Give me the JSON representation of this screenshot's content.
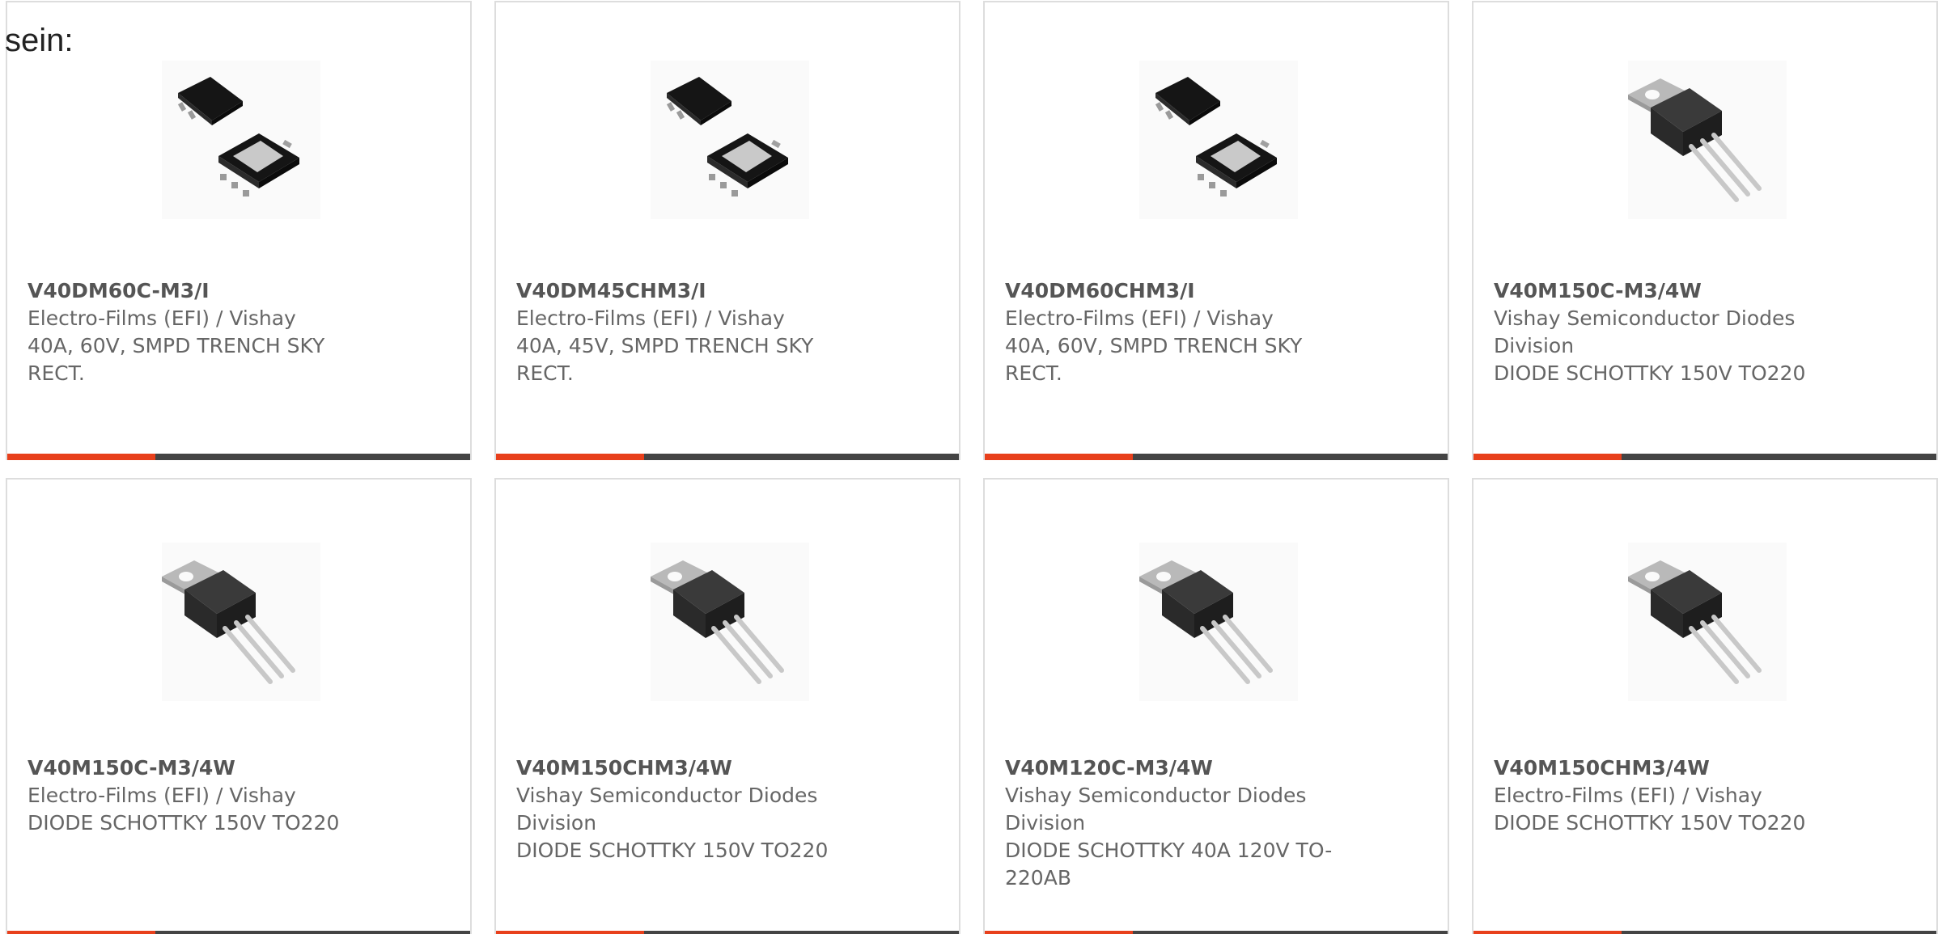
{
  "intro_text": "sein:",
  "colors": {
    "accent": "#e8401c",
    "bar": "#444444",
    "border": "#dddddd",
    "text": "#666666",
    "part_number": "#555555"
  },
  "products": [
    {
      "part_number": "V40DM60C-M3/I",
      "manufacturer": "Electro-Films (EFI) / Vishay",
      "description": "40A, 60V, SMPD TRENCH SKY RECT.",
      "image_icon": "smpd-package-icon"
    },
    {
      "part_number": "V40DM45CHM3/I",
      "manufacturer": "Electro-Films (EFI) / Vishay",
      "description": "40A, 45V, SMPD TRENCH SKY RECT.",
      "image_icon": "smpd-package-icon"
    },
    {
      "part_number": "V40DM60CHM3/I",
      "manufacturer": "Electro-Films (EFI) / Vishay",
      "description": "40A, 60V, SMPD TRENCH SKY RECT.",
      "image_icon": "smpd-package-icon"
    },
    {
      "part_number": "V40M150C-M3/4W",
      "manufacturer": "Vishay Semiconductor Diodes Division",
      "description": "DIODE SCHOTTKY 150V TO220",
      "image_icon": "to220-package-icon"
    },
    {
      "part_number": "V40M150C-M3/4W",
      "manufacturer": "Electro-Films (EFI) / Vishay",
      "description": "DIODE SCHOTTKY 150V TO220",
      "image_icon": "to220-package-icon"
    },
    {
      "part_number": "V40M150CHM3/4W",
      "manufacturer": "Vishay Semiconductor Diodes Division",
      "description": "DIODE SCHOTTKY 150V TO220",
      "image_icon": "to220-package-icon"
    },
    {
      "part_number": "V40M120C-M3/4W",
      "manufacturer": "Vishay Semiconductor Diodes Division",
      "description": "DIODE SCHOTTKY 40A 120V TO-220AB",
      "image_icon": "to220-package-icon"
    },
    {
      "part_number": "V40M150CHM3/4W",
      "manufacturer": "Electro-Films (EFI) / Vishay",
      "description": "DIODE SCHOTTKY 150V TO220",
      "image_icon": "to220-package-icon"
    }
  ]
}
